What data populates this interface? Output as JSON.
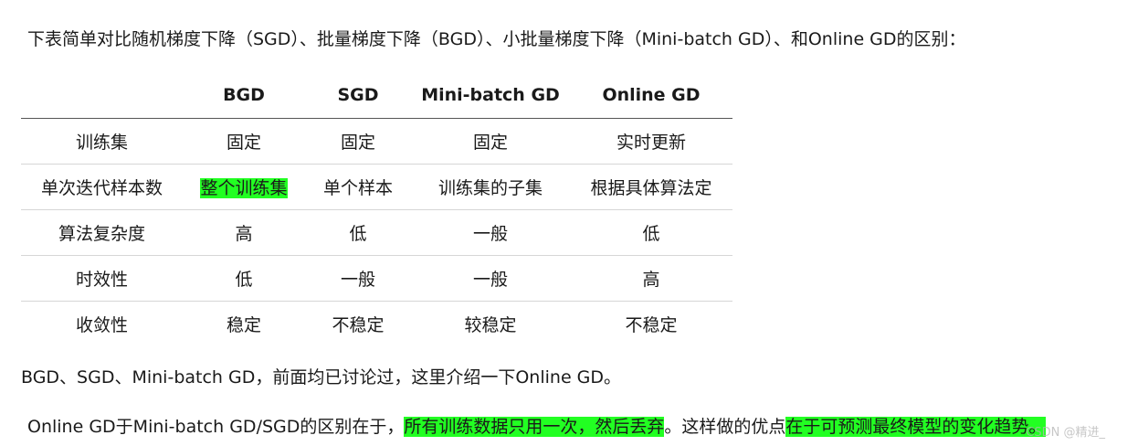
{
  "intro": "下表简单对比随机梯度下降（SGD）、批量梯度下降（BGD）、小批量梯度下降（Mini-batch GD）、和Online GD的区别：",
  "table": {
    "headers": [
      "",
      "BGD",
      "SGD",
      "Mini-batch GD",
      "Online GD"
    ],
    "rows": [
      [
        "训练集",
        "固定",
        "固定",
        "固定",
        "实时更新"
      ],
      [
        "单次迭代样本数",
        "整个训练集",
        "单个样本",
        "训练集的子集",
        "根据具体算法定"
      ],
      [
        "算法复杂度",
        "高",
        "低",
        "一般",
        "低"
      ],
      [
        "时效性",
        "低",
        "一般",
        "一般",
        "高"
      ],
      [
        "收敛性",
        "稳定",
        "不稳定",
        "较稳定",
        "不稳定"
      ]
    ]
  },
  "para1": "BGD、SGD、Mini-batch GD，前面均已讨论过，这里介绍一下Online GD。",
  "para2": {
    "part1": "Online GD于Mini-batch GD/SGD的区别在于，",
    "highlight1": "所有训练数据只用一次，然后丢弃",
    "part2": "。这样做的优点",
    "highlight2": "在于可预测最终模型的变化趋势。"
  },
  "watermark": "CSDN @精进_",
  "colors": {
    "highlight": "#22ff22",
    "text": "#1a1a1a",
    "header_rule": "#555555",
    "row_rule": "#d6d6d6"
  }
}
